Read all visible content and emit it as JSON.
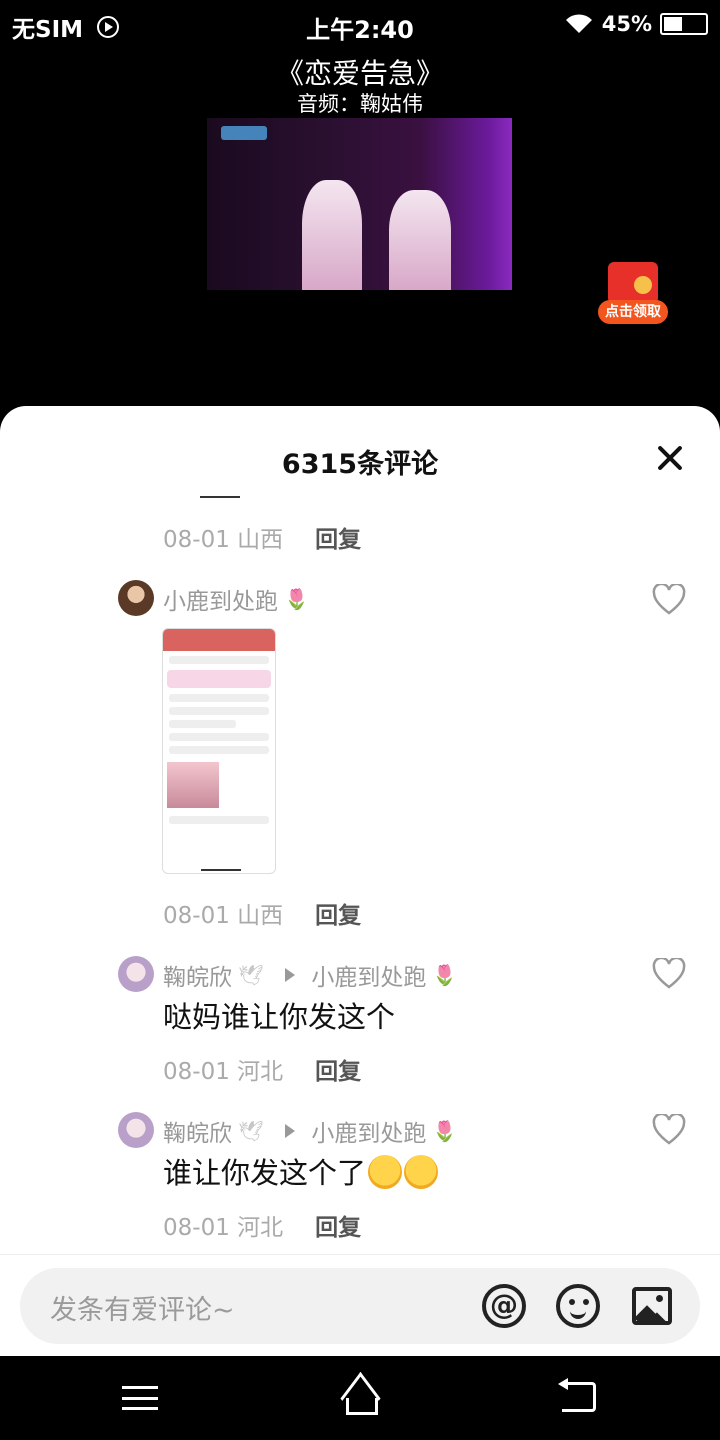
{
  "status_bar": {
    "carrier": "无SIM",
    "time": "上午2:40",
    "battery": "45%",
    "battery_level": 0.45
  },
  "video": {
    "title": "《恋爱告急》",
    "subtitle": "音频：鞠姑伟",
    "redpacket_label": "点击领取"
  },
  "comments_sheet": {
    "title": "6315条评论",
    "comments": [
      {
        "date": "08-01",
        "region": "山西",
        "reply": "回复"
      },
      {
        "user": "小鹿到处跑",
        "date": "08-01",
        "region": "山西",
        "reply": "回复"
      },
      {
        "user": "鞠皖欣",
        "reply_to": "小鹿到处跑",
        "text": "哒妈谁让你发这个",
        "date": "08-01",
        "region": "河北",
        "reply": "回复"
      },
      {
        "user": "鞠皖欣",
        "reply_to": "小鹿到处跑",
        "text": "谁让你发这个了",
        "date": "08-01",
        "region": "河北",
        "reply": "回复"
      }
    ]
  },
  "input_bar": {
    "placeholder": "发条有爱评论~",
    "at_symbol": "@"
  },
  "icons": {
    "flower": "🌷",
    "dove": "🕊"
  }
}
